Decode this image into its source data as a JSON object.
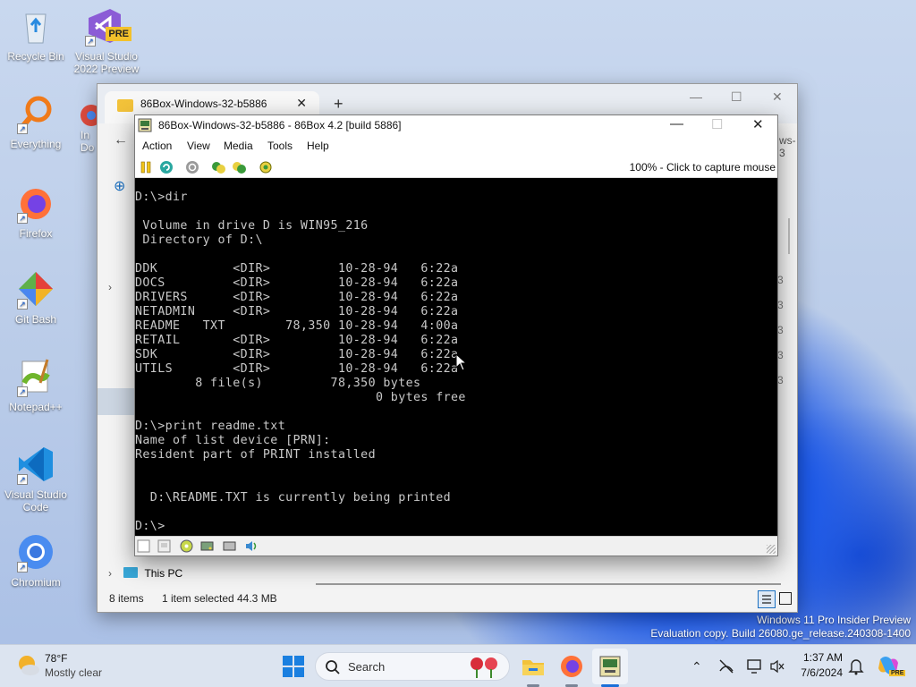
{
  "desktop": {
    "icons": [
      {
        "label": "Recycle Bin",
        "icon": "recycle-bin-icon"
      },
      {
        "label": "Visual Studio 2022 Preview",
        "badge": "PRE",
        "icon": "visual-studio-icon"
      },
      {
        "label": "Everything",
        "icon": "everything-search-icon"
      },
      {
        "label": "In Do",
        "icon": "chrome-icon"
      },
      {
        "label": "Firefox",
        "icon": "firefox-icon"
      },
      {
        "label": "Git Bash",
        "icon": "git-bash-icon"
      },
      {
        "label": "Notepad++",
        "icon": "notepadpp-icon"
      },
      {
        "label": "Visual Studio Code",
        "icon": "vscode-icon"
      },
      {
        "label": "Chromium",
        "icon": "chromium-icon"
      }
    ],
    "watermark_line1": "Windows 11 Pro Insider Preview",
    "watermark_line2": "Evaluation copy. Build 26080.ge_release.240308-1400"
  },
  "explorer": {
    "tab_title": "86Box-Windows-32-b5886",
    "tab_close": "✕",
    "new_tab": "+",
    "minimize": "—",
    "maximize": "☐",
    "close": "✕",
    "back": "←",
    "add": "⊕",
    "address_fragment": "ws-3",
    "nav_this_pc": "This PC",
    "status_items": "8 items",
    "status_selected": "1 item selected",
    "status_size": "44.3 MB",
    "right_col": [
      "3",
      "3",
      "3",
      "3",
      "3"
    ]
  },
  "box86": {
    "title": "86Box-Windows-32-b5886 - 86Box 4.2 [build 5886]",
    "minimize": "—",
    "maximize": "☐",
    "close": "✕",
    "menu": [
      "Action",
      "View",
      "Media",
      "Tools",
      "Help"
    ],
    "capture_text": "100% - Click to capture mouse",
    "screen_lines": [
      "D:\\>dir",
      "",
      " Volume in drive D is WIN95_216",
      " Directory of D:\\",
      "",
      "DDK          <DIR>         10-28-94   6:22a",
      "DOCS         <DIR>         10-28-94   6:22a",
      "DRIVERS      <DIR>         10-28-94   6:22a",
      "NETADMIN     <DIR>         10-28-94   6:22a",
      "README   TXT        78,350 10-28-94   4:00a",
      "RETAIL       <DIR>         10-28-94   6:22a",
      "SDK          <DIR>         10-28-94   6:22a",
      "UTILS        <DIR>         10-28-94   6:22a",
      "        8 file(s)         78,350 bytes",
      "                                0 bytes free",
      "",
      "D:\\>print readme.txt",
      "Name of list device [PRN]:",
      "Resident part of PRINT installed",
      "",
      "",
      "  D:\\README.TXT is currently being printed",
      "",
      "D:\\>"
    ]
  },
  "taskbar": {
    "weather_temp": "78°F",
    "weather_desc": "Mostly clear",
    "search_label": "Search",
    "time": "1:37 AM",
    "date": "7/6/2024",
    "tray_chevron": "⌃"
  },
  "colors": {
    "accent": "#0067c0",
    "dos_text": "#c8c8c8",
    "dos_bg": "#000000"
  }
}
